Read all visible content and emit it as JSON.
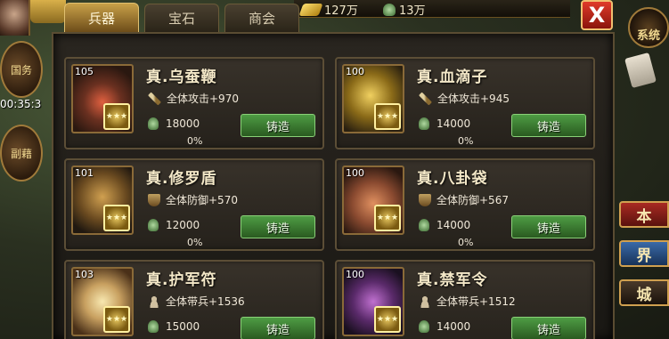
{
  "resources": {
    "gold": "127万",
    "jade": "13万"
  },
  "tabs": [
    {
      "label": "兵器",
      "active": true
    },
    {
      "label": "宝石",
      "active": false
    },
    {
      "label": "商会",
      "active": false
    }
  ],
  "close_label": "X",
  "left_menu": {
    "top_button": "国务",
    "timer": "00:35:3",
    "bottom_button": "副藉"
  },
  "right_menu": {
    "system": "系统",
    "btn1": "本",
    "btn2": "界",
    "btn3": "城"
  },
  "items": [
    {
      "level": "105",
      "name": "真.乌蚕鞭",
      "stat_icon": "sword-icon",
      "stat": "全体攻击+970",
      "cost": "18000",
      "progress": "0%",
      "button": "铸造"
    },
    {
      "level": "100",
      "name": "真.血滴子",
      "stat_icon": "sword-icon",
      "stat": "全体攻击+945",
      "cost": "14000",
      "progress": "0%",
      "button": "铸造"
    },
    {
      "level": "101",
      "name": "真.修罗盾",
      "stat_icon": "shield-icon",
      "stat": "全体防御+570",
      "cost": "12000",
      "progress": "0%",
      "button": "铸造"
    },
    {
      "level": "100",
      "name": "真.八卦袋",
      "stat_icon": "shield-icon",
      "stat": "全体防御+567",
      "cost": "14000",
      "progress": "0%",
      "button": "铸造"
    },
    {
      "level": "103",
      "name": "真.护军符",
      "stat_icon": "person-icon",
      "stat": "全体带兵+1536",
      "cost": "15000",
      "progress": "",
      "button": "铸造"
    },
    {
      "level": "100",
      "name": "真.禁军令",
      "stat_icon": "person-icon",
      "stat": "全体带兵+1512",
      "cost": "14000",
      "progress": "",
      "button": "铸造"
    }
  ],
  "colors": {
    "forge_button": "#3f8a36",
    "active_tab": "#c8a048",
    "close_button": "#e03a2a"
  }
}
